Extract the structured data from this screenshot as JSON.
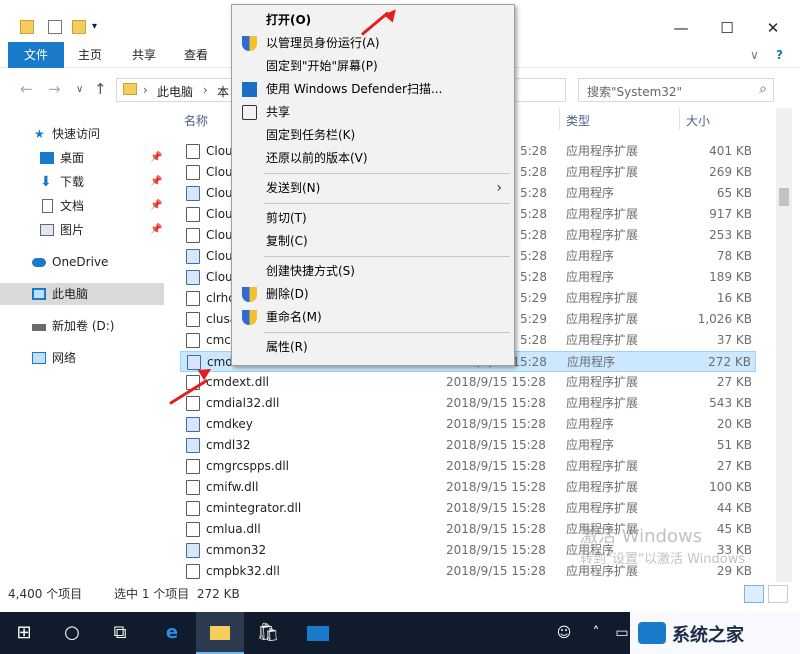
{
  "window": {
    "controls": {
      "minimize": "—",
      "maximize": "☐",
      "close": "✕"
    }
  },
  "ribbon": {
    "tabs": [
      "文件",
      "主页",
      "共享",
      "查看"
    ],
    "help": "?",
    "expand": "∨"
  },
  "address": {
    "back": "←",
    "forward": "→",
    "history": "∨",
    "up": "↑",
    "path": [
      "此电脑",
      "本"
    ],
    "sep": "›",
    "search_placeholder": "搜索\"System32\"",
    "search_glyph": "⌕"
  },
  "sidebar": {
    "items": [
      {
        "label": "快速访问",
        "icon": "star-icon"
      },
      {
        "label": "桌面",
        "icon": "desktop-icon",
        "pinned": true
      },
      {
        "label": "下载",
        "icon": "download-icon",
        "pinned": true
      },
      {
        "label": "文档",
        "icon": "document-icon",
        "pinned": true
      },
      {
        "label": "图片",
        "icon": "picture-icon",
        "pinned": true
      },
      {
        "label": "OneDrive",
        "icon": "cloud-icon"
      },
      {
        "label": "此电脑",
        "icon": "computer-icon",
        "selected": true
      },
      {
        "label": "新加卷 (D:)",
        "icon": "drive-icon"
      },
      {
        "label": "网络",
        "icon": "network-icon"
      }
    ]
  },
  "columns": {
    "name": "名称",
    "type": "类型",
    "size": "大小"
  },
  "files": [
    {
      "name": "Clou",
      "date": "5:28",
      "type": "应用程序扩展",
      "size": "401 KB"
    },
    {
      "name": "Clou",
      "date": "5:28",
      "type": "应用程序扩展",
      "size": "269 KB"
    },
    {
      "name": "Clou",
      "date": "5:28",
      "type": "应用程序",
      "size": "65 KB",
      "exe": true
    },
    {
      "name": "Clou",
      "date": "5:28",
      "type": "应用程序扩展",
      "size": "917 KB"
    },
    {
      "name": "Clou",
      "date": "5:28",
      "type": "应用程序扩展",
      "size": "253 KB"
    },
    {
      "name": "Clou",
      "date": "5:28",
      "type": "应用程序",
      "size": "78 KB",
      "exe": true
    },
    {
      "name": "Clou",
      "date": "5:28",
      "type": "应用程序",
      "size": "189 KB",
      "exe": true
    },
    {
      "name": "clrhc",
      "date": "5:29",
      "type": "应用程序扩展",
      "size": "16 KB"
    },
    {
      "name": "clusa",
      "date": "5:29",
      "type": "应用程序扩展",
      "size": "1,026 KB"
    },
    {
      "name": "cmc",
      "date": "5:28",
      "type": "应用程序扩展",
      "size": "37 KB"
    },
    {
      "name": "cmd",
      "date": "2018/9/15 15:28",
      "type": "应用程序",
      "size": "272 KB",
      "exe": true,
      "selected": true
    },
    {
      "name": "cmdext.dll",
      "date": "2018/9/15 15:28",
      "type": "应用程序扩展",
      "size": "27 KB"
    },
    {
      "name": "cmdial32.dll",
      "date": "2018/9/15 15:28",
      "type": "应用程序扩展",
      "size": "543 KB"
    },
    {
      "name": "cmdkey",
      "date": "2018/9/15 15:28",
      "type": "应用程序",
      "size": "20 KB",
      "exe": true
    },
    {
      "name": "cmdl32",
      "date": "2018/9/15 15:28",
      "type": "应用程序",
      "size": "51 KB",
      "exe": true
    },
    {
      "name": "cmgrcspps.dll",
      "date": "2018/9/15 15:28",
      "type": "应用程序扩展",
      "size": "27 KB"
    },
    {
      "name": "cmifw.dll",
      "date": "2018/9/15 15:28",
      "type": "应用程序扩展",
      "size": "100 KB"
    },
    {
      "name": "cmintegrator.dll",
      "date": "2018/9/15 15:28",
      "type": "应用程序扩展",
      "size": "44 KB"
    },
    {
      "name": "cmlua.dll",
      "date": "2018/9/15 15:28",
      "type": "应用程序扩展",
      "size": "45 KB"
    },
    {
      "name": "cmmon32",
      "date": "2018/9/15 15:28",
      "type": "应用程序",
      "size": "33 KB",
      "exe": true
    },
    {
      "name": "cmpbk32.dll",
      "date": "2018/9/15 15:28",
      "type": "应用程序扩展",
      "size": "29 KB"
    }
  ],
  "status": {
    "count": "4,400 个项目",
    "selection": "选中 1 个项目  272 KB"
  },
  "context_menu": [
    {
      "label": "打开(O)",
      "bold": true
    },
    {
      "label": "以管理员身份运行(A)",
      "icon": "uac-shield-icon"
    },
    {
      "label": "固定到\"开始\"屏幕(P)"
    },
    {
      "label": "使用 Windows Defender扫描...",
      "icon": "defender-icon"
    },
    {
      "label": "共享",
      "icon": "share-icon"
    },
    {
      "label": "固定到任务栏(K)"
    },
    {
      "label": "还原以前的版本(V)"
    },
    {
      "sep": true
    },
    {
      "label": "发送到(N)",
      "submenu": true
    },
    {
      "sep": true
    },
    {
      "label": "剪切(T)"
    },
    {
      "label": "复制(C)"
    },
    {
      "sep": true
    },
    {
      "label": "创建快捷方式(S)"
    },
    {
      "label": "删除(D)",
      "icon": "uac-shield-icon"
    },
    {
      "label": "重命名(M)",
      "icon": "uac-shield-icon"
    },
    {
      "sep": true
    },
    {
      "label": "属性(R)"
    }
  ],
  "watermark": {
    "line1": "激活 Windows",
    "line2": "转到\"设置\"以激活 Windows",
    "brand": "系统之家"
  },
  "colors": {
    "accent": "#1979ca",
    "selection": "#cce8ff",
    "taskbar": "#101c2b",
    "annotation": "#e02020"
  }
}
